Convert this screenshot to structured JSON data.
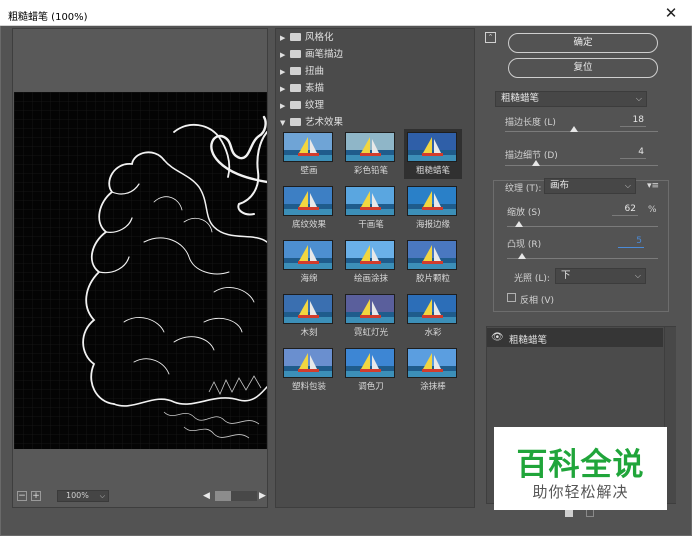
{
  "window": {
    "title": "粗糙蜡笔 (100%)",
    "close_glyph": "✕"
  },
  "preview": {
    "zoom": "100%"
  },
  "categories": [
    {
      "label": "风格化",
      "expanded": false
    },
    {
      "label": "画笔描边",
      "expanded": false
    },
    {
      "label": "扭曲",
      "expanded": false
    },
    {
      "label": "素描",
      "expanded": false
    },
    {
      "label": "纹理",
      "expanded": false
    },
    {
      "label": "艺术效果",
      "expanded": true
    }
  ],
  "filters": [
    {
      "label": "壁画",
      "selected": false
    },
    {
      "label": "彩色铅笔",
      "selected": false
    },
    {
      "label": "粗糙蜡笔",
      "selected": true
    },
    {
      "label": "底纹效果",
      "selected": false
    },
    {
      "label": "干画笔",
      "selected": false
    },
    {
      "label": "海报边缘",
      "selected": false
    },
    {
      "label": "海绵",
      "selected": false
    },
    {
      "label": "绘画涂抹",
      "selected": false
    },
    {
      "label": "胶片颗粒",
      "selected": false
    },
    {
      "label": "木刻",
      "selected": false
    },
    {
      "label": "霓虹灯光",
      "selected": false
    },
    {
      "label": "水彩",
      "selected": false
    },
    {
      "label": "塑料包装",
      "selected": false
    },
    {
      "label": "调色刀",
      "selected": false
    },
    {
      "label": "涂抹棒",
      "selected": false
    }
  ],
  "buttons": {
    "ok": "确定",
    "reset": "复位"
  },
  "settings": {
    "filter_select": "粗糙蜡笔",
    "stroke_length": {
      "label": "描边长度 (L)",
      "value": "18",
      "level": 0.45
    },
    "stroke_detail": {
      "label": "描边细节 (D)",
      "value": "4",
      "level": 0.2
    },
    "texture": {
      "label": "纹理 (T):",
      "value": "画布"
    },
    "scaling": {
      "label": "缩放 (S)",
      "value": "62",
      "unit": "%",
      "level": 0.08
    },
    "relief": {
      "label": "凸现 (R)",
      "value": "5",
      "level": 0.1
    },
    "light": {
      "label": "光照 (L):",
      "value": "下"
    },
    "invert": {
      "label": "反相 (V)",
      "checked": false
    }
  },
  "layers": [
    {
      "name": "粗糙蜡笔",
      "visible": true
    }
  ],
  "watermark": {
    "title": "百科全说",
    "subtitle": "助你轻松解决"
  },
  "colors": {
    "panel": "#535353",
    "selected_cell": "#303030",
    "active_value": "#4b8bd8",
    "watermark_green": "#20a53a"
  }
}
